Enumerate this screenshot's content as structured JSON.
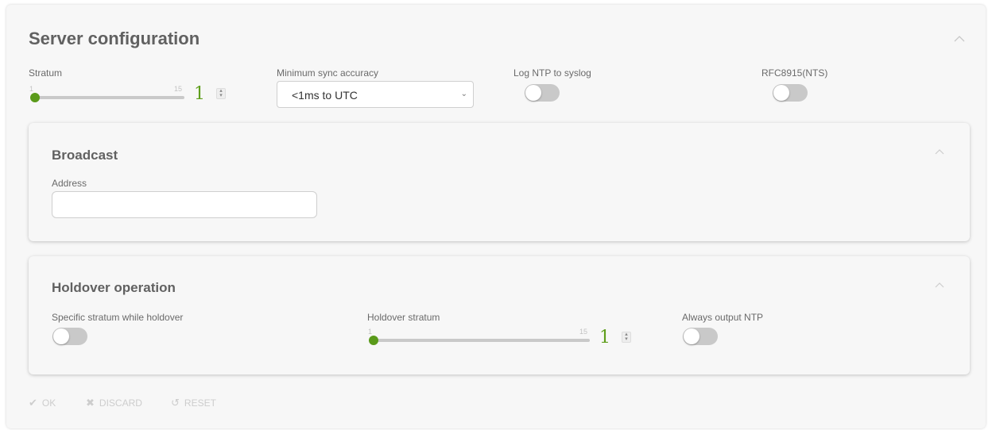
{
  "server_config": {
    "title": "Server configuration",
    "stratum": {
      "label": "Stratum",
      "min": "1",
      "max": "15",
      "value": "1",
      "fraction": 0.0
    },
    "min_sync_accuracy": {
      "label": "Minimum sync accuracy",
      "selected": "<1ms to UTC"
    },
    "log_ntp": {
      "label": "Log NTP to syslog",
      "checked": false
    },
    "rfc8915": {
      "label": "RFC8915(NTS)",
      "checked": false
    }
  },
  "broadcast": {
    "title": "Broadcast",
    "address": {
      "label": "Address",
      "value": ""
    }
  },
  "holdover": {
    "title": "Holdover operation",
    "specific_stratum": {
      "label": "Specific stratum while holdover",
      "checked": false
    },
    "holdover_stratum": {
      "label": "Holdover stratum",
      "min": "1",
      "max": "15",
      "value": "1",
      "fraction": 0.0
    },
    "always_output": {
      "label": "Always output NTP",
      "checked": false
    }
  },
  "footer": {
    "ok": "OK",
    "discard": "DISCARD",
    "reset": "RESET"
  },
  "colors": {
    "accent": "#5a9a1a",
    "toggle_off": "#c9c9c9",
    "disabled": "#cdcdcd"
  },
  "icons": {
    "collapse": "chevron-up-icon",
    "ok": "check-icon",
    "discard": "x-icon",
    "reset": "undo-icon"
  }
}
